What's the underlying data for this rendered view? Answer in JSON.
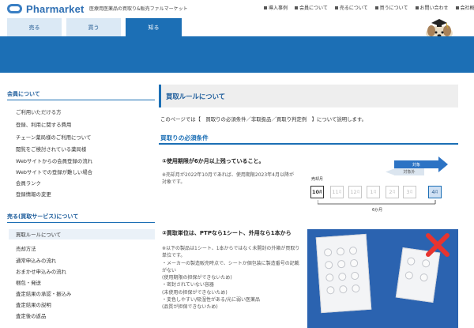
{
  "brand": {
    "name": "Pharmarket",
    "tagline": "医療用医薬品の買取り&販売ファルマーケット"
  },
  "top_links": [
    "導入事例",
    "会員について",
    "売るについて",
    "買うについて",
    "お問い合わせ",
    "会社概要"
  ],
  "tabs": [
    "売る",
    "買う",
    "知る"
  ],
  "active_tab": "知る",
  "sidebar": {
    "section1": {
      "heading": "会員について",
      "items": [
        "ご利用いただける方",
        "登録、利用に関する費用",
        "チェーン薬局様のご利用について",
        "閲覧をご検討されている薬局様",
        "Webサイトからの会員登録の流れ",
        "Webサイトでの登録が難しい場合",
        "会員ランク",
        "登録情報の変更"
      ]
    },
    "section2": {
      "heading": "売る(買取サービス)について",
      "items": [
        "買取ルールについて",
        "売却方法",
        "通常申込みの流れ",
        "おまかせ申込みの流れ",
        "梱包・発送",
        "査定結果の承認・振込み",
        "査定結果の説明",
        "査定後の返品"
      ],
      "active_index": 0
    }
  },
  "main": {
    "title": "買取ルールについて",
    "intro": "このページでは【　買取りの必須条件／非取扱品／買取り判定例　】について説明します。",
    "section_title": "買取りの必須条件",
    "point1": {
      "title": "①使用期限が6か月以上残っていること。",
      "note": [
        "※売却月が2022年10月であれば、使用期限2023年4月以降が",
        "対象です。"
      ]
    },
    "diagram": {
      "label_sell_month": "売却月",
      "label_non_target": "対象外",
      "label_target": "対象",
      "label_span": "6か月",
      "months": [
        "10",
        "11",
        "12",
        "1",
        "2",
        "3",
        "4"
      ],
      "month_suffix": "月"
    },
    "point2": {
      "title": "②買取単位は、PTPなら1シート、外用なら1本から",
      "note": [
        "※以下の製品は1シート、1本からではなく未開封の外箱が買取り",
        "単位です。",
        "・メーカーの製造販売時点で、シートか個包装に製造番号の記載",
        "がない",
        "(使用期限の担保ができないため)",
        "・密封されていない容器",
        "(未使用の担保ができないため)",
        "・変色しやすい/吸湿性がある/光に弱い医薬品",
        "(品質が担保できないため)"
      ]
    }
  },
  "colors": {
    "brand_blue": "#1c6fb5",
    "tab_inactive": "#dbe9f5",
    "highlight": "#eaf1f8",
    "reject_red": "#e8342f"
  }
}
